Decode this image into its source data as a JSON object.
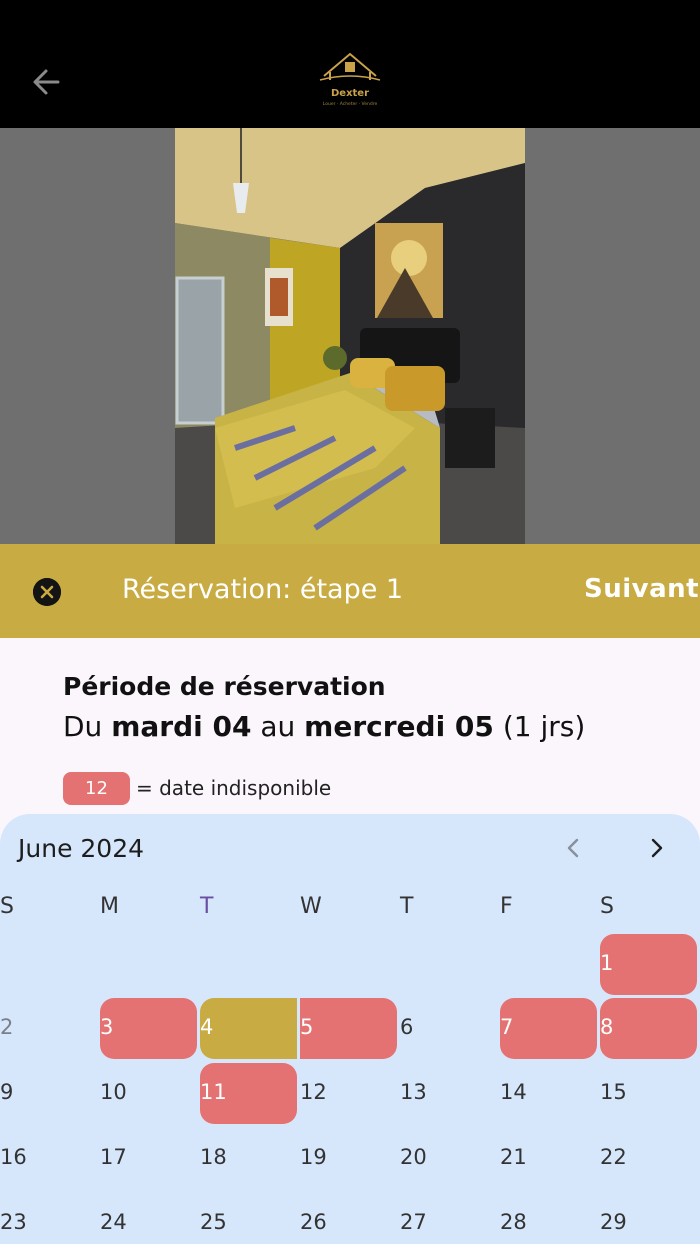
{
  "header": {
    "back_icon": "arrow-left-icon",
    "logo": {
      "name": "Dexter",
      "tagline": "Louer · Acheter · Vendre"
    }
  },
  "step_bar": {
    "close_icon": "close-circle-icon",
    "title": "Réservation: étape 1",
    "next_label": "Suivant",
    "color": "#c9ab43"
  },
  "period": {
    "title": "Période de réservation",
    "prefix": "Du",
    "start": "mardi 04",
    "middle": "au",
    "end": "mercredi 05",
    "duration": "(1 jrs)"
  },
  "legend": {
    "chip_value": "12",
    "text": "= date indisponible",
    "unavailable_color": "#e57272"
  },
  "calendar": {
    "month_label": "June 2024",
    "prev_icon": "chevron-left-icon",
    "next_icon": "chevron-right-icon",
    "weekdays": [
      "S",
      "M",
      "T",
      "W",
      "T",
      "F",
      "S"
    ],
    "today_weekday_index": 2,
    "weeks": [
      [
        "",
        "",
        "",
        "",
        "",
        "",
        "1"
      ],
      [
        "2",
        "3",
        "4",
        "5",
        "6",
        "7",
        "8"
      ],
      [
        "9",
        "10",
        "11",
        "12",
        "13",
        "14",
        "15"
      ],
      [
        "16",
        "17",
        "18",
        "19",
        "20",
        "21",
        "22"
      ],
      [
        "23",
        "24",
        "25",
        "26",
        "27",
        "28",
        "29"
      ]
    ],
    "unavailable_days": [
      "1",
      "3",
      "5",
      "7",
      "8",
      "11"
    ],
    "selected_start": "4",
    "selected_end": "5",
    "greyed_days": [
      "2"
    ]
  }
}
